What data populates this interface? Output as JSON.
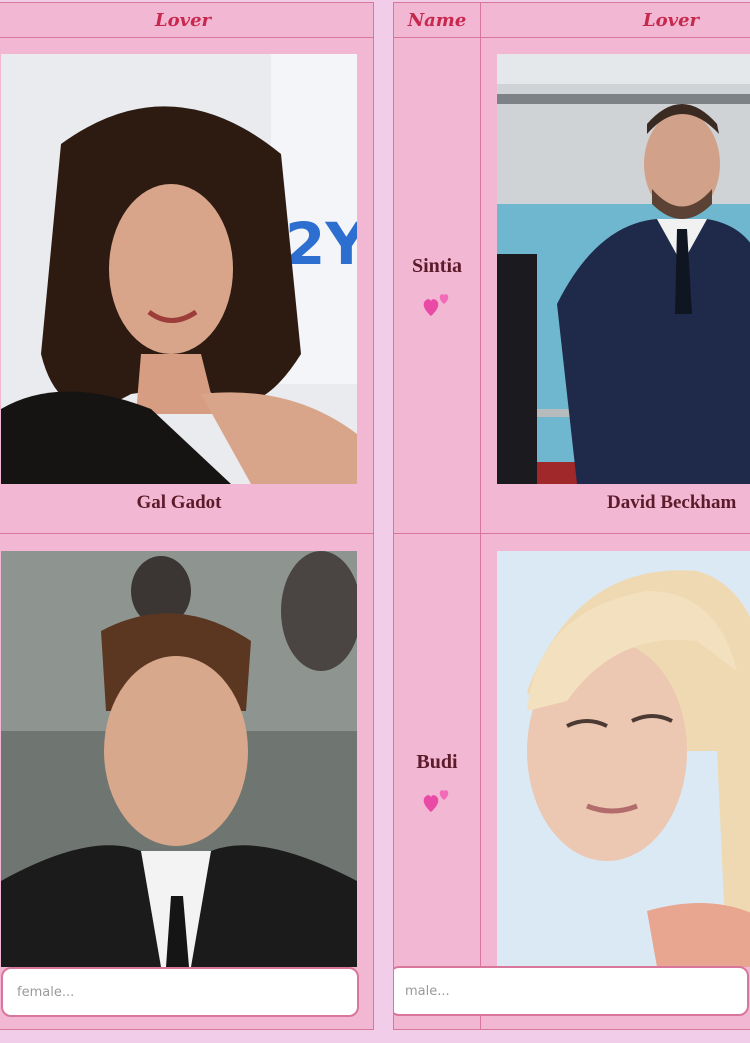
{
  "left_column": {
    "header": "Lover",
    "cards": [
      {
        "name": "Gal Gadot"
      },
      {
        "name": ""
      }
    ],
    "input": {
      "value": "",
      "placeholder": "female..."
    }
  },
  "right_column": {
    "headers": {
      "name": "Name",
      "lover": "Lover"
    },
    "rows": [
      {
        "user": "Sintia",
        "lover_name": "David Beckham"
      },
      {
        "user": "Budi",
        "lover_name": ""
      }
    ],
    "input": {
      "value": "",
      "placeholder": "male..."
    }
  },
  "colors": {
    "background": "#f1cde9",
    "panel": "#f2b7d2",
    "border": "#d9769c",
    "header_text": "#c7284d",
    "name_text": "#5b1b2a"
  },
  "icons": [
    "two-hearts-icon",
    "two-hearts-icon"
  ]
}
